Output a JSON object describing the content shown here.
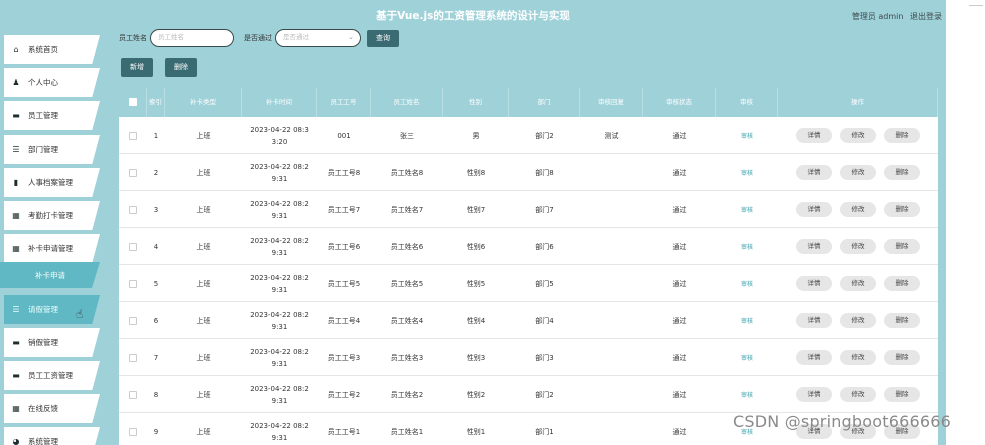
{
  "header": {
    "title": "基于Vue.js的工资管理系统的设计与实现",
    "user": "管理员 admin",
    "logout": "退出登录"
  },
  "sidebar": {
    "items": [
      {
        "label": "系统首页",
        "icon": "home-icon",
        "glyph": "⌂"
      },
      {
        "label": "个人中心",
        "icon": "user-icon",
        "glyph": "♟"
      },
      {
        "label": "员工管理",
        "icon": "briefcase-icon",
        "glyph": "▬"
      },
      {
        "label": "部门管理",
        "icon": "list-icon",
        "glyph": "☰"
      },
      {
        "label": "人事档案管理",
        "icon": "file-icon",
        "glyph": "▮"
      },
      {
        "label": "考勤打卡管理",
        "icon": "grid-icon",
        "glyph": "▦"
      },
      {
        "label": "补卡申请管理",
        "icon": "grid-icon",
        "glyph": "▦"
      },
      {
        "label": "补卡申请",
        "icon": "",
        "glyph": ""
      },
      {
        "label": "请假管理",
        "icon": "list-icon",
        "glyph": "☰"
      },
      {
        "label": "销假管理",
        "icon": "monitor-icon",
        "glyph": "▬"
      },
      {
        "label": "员工工资管理",
        "icon": "wallet-icon",
        "glyph": "▬"
      },
      {
        "label": "在线反馈",
        "icon": "grid-icon",
        "glyph": "▦"
      },
      {
        "label": "系统管理",
        "icon": "settings-icon",
        "glyph": "◕"
      }
    ]
  },
  "search": {
    "name_label": "员工姓名",
    "name_placeholder": "员工姓名",
    "pass_label": "是否通过",
    "pass_placeholder": "是否通过",
    "query_button": "查询"
  },
  "actions": {
    "add": "新增",
    "delete": "删除"
  },
  "table": {
    "columns": [
      "",
      "索引",
      "补卡类型",
      "补卡时间",
      "员工工号",
      "员工姓名",
      "性别",
      "部门",
      "审核回复",
      "审核状态",
      "审核",
      "操作"
    ],
    "rows": [
      {
        "index": "1",
        "type": "上班",
        "time": "2023-04-22 08:33:20",
        "time_a": "2023-04-22 08:3",
        "time_b": "3:20",
        "emp_no": "001",
        "name": "张三",
        "gender": "男",
        "dept": "部门2",
        "reply": "测试",
        "status": "通过",
        "audit": "审核"
      },
      {
        "index": "2",
        "type": "上班",
        "time": "2023-04-22 08:29:31",
        "time_a": "2023-04-22 08:2",
        "time_b": "9:31",
        "emp_no": "员工工号8",
        "name": "员工姓名8",
        "gender": "性别8",
        "dept": "部门8",
        "reply": "",
        "status": "通过",
        "audit": "审核"
      },
      {
        "index": "3",
        "type": "上班",
        "time": "2023-04-22 08:29:31",
        "time_a": "2023-04-22 08:2",
        "time_b": "9:31",
        "emp_no": "员工工号7",
        "name": "员工姓名7",
        "gender": "性别7",
        "dept": "部门7",
        "reply": "",
        "status": "通过",
        "audit": "审核"
      },
      {
        "index": "4",
        "type": "上班",
        "time": "2023-04-22 08:29:31",
        "time_a": "2023-04-22 08:2",
        "time_b": "9:31",
        "emp_no": "员工工号6",
        "name": "员工姓名6",
        "gender": "性别6",
        "dept": "部门6",
        "reply": "",
        "status": "通过",
        "audit": "审核"
      },
      {
        "index": "5",
        "type": "上班",
        "time": "2023-04-22 08:29:31",
        "time_a": "2023-04-22 08:2",
        "time_b": "9:31",
        "emp_no": "员工工号5",
        "name": "员工姓名5",
        "gender": "性别5",
        "dept": "部门5",
        "reply": "",
        "status": "通过",
        "audit": "审核"
      },
      {
        "index": "6",
        "type": "上班",
        "time": "2023-04-22 08:29:31",
        "time_a": "2023-04-22 08:2",
        "time_b": "9:31",
        "emp_no": "员工工号4",
        "name": "员工姓名4",
        "gender": "性别4",
        "dept": "部门4",
        "reply": "",
        "status": "通过",
        "audit": "审核"
      },
      {
        "index": "7",
        "type": "上班",
        "time": "2023-04-22 08:29:31",
        "time_a": "2023-04-22 08:2",
        "time_b": "9:31",
        "emp_no": "员工工号3",
        "name": "员工姓名3",
        "gender": "性别3",
        "dept": "部门3",
        "reply": "",
        "status": "通过",
        "audit": "审核"
      },
      {
        "index": "8",
        "type": "上班",
        "time": "2023-04-22 08:29:31",
        "time_a": "2023-04-22 08:2",
        "time_b": "9:31",
        "emp_no": "员工工号2",
        "name": "员工姓名2",
        "gender": "性别2",
        "dept": "部门2",
        "reply": "",
        "status": "通过",
        "audit": "审核"
      },
      {
        "index": "9",
        "type": "上班",
        "time": "2023-04-22 08:29:31",
        "time_a": "2023-04-22 08:2",
        "time_b": "9:31",
        "emp_no": "员工工号1",
        "name": "员工姓名1",
        "gender": "性别1",
        "dept": "部门1",
        "reply": "",
        "status": "通过",
        "audit": "审核"
      }
    ],
    "op_labels": [
      "详情",
      "修改",
      "删除"
    ]
  },
  "watermark": "CSDN @springboot666666",
  "colors": {
    "theme": "#9fd1d9",
    "active": "#5fb8c3",
    "button_dark": "#3a6b72",
    "link": "#3aa1ad"
  }
}
